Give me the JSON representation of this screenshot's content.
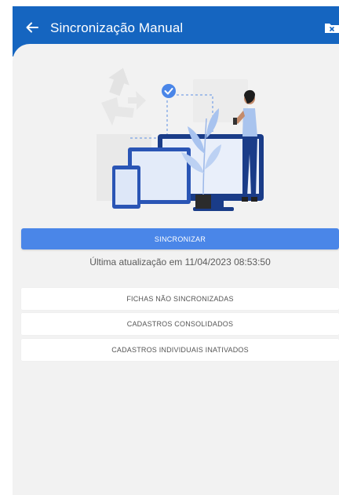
{
  "app_bar": {
    "title": "Sincronização Manual",
    "back_icon": "arrow-left-icon",
    "action_icon": "folder-close-icon",
    "background": "#1565c0"
  },
  "main": {
    "illustration": "person-syncing-devices-illustration",
    "sync_button_label": "SINCRONIZAR",
    "last_update": "Última atualização em 11/04/2023 08:53:50",
    "options": [
      {
        "label": "FICHAS NÃO SINCRONIZADAS"
      },
      {
        "label": "CADASTROS CONSOLIDADOS"
      },
      {
        "label": "CADASTROS INDIVIDUAIS INATIVADOS"
      }
    ],
    "accent": "#4a86e8",
    "background": "#f2f2f2"
  }
}
